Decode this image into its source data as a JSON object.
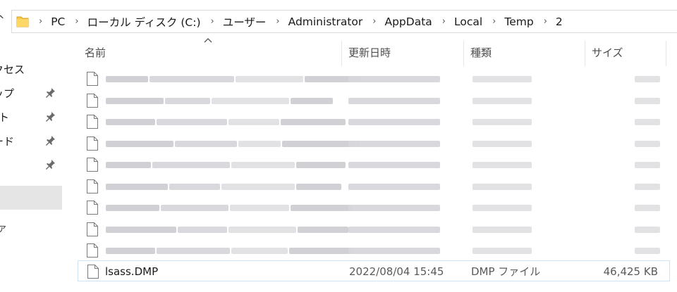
{
  "address_bar": {
    "up_arrow": "^",
    "crumbs": [
      "PC",
      "ローカル ディスク (C:)",
      "ユーザー",
      "Administrator",
      "AppData",
      "Local",
      "Temp",
      "2"
    ],
    "separator": "›"
  },
  "nav_pane": {
    "items": [
      {
        "label": "クセス",
        "pinned": false
      },
      {
        "label": "ップ",
        "pinned": true
      },
      {
        "label": "ト",
        "pinned": true
      },
      {
        "label": "ード",
        "pinned": true
      },
      {
        "label": "",
        "pinned": true
      }
    ],
    "partial_label": "ァ"
  },
  "columns": {
    "name": "名前",
    "date": "更新日時",
    "type": "種類",
    "size": "サイズ"
  },
  "files": {
    "blurred_rows": 9,
    "visible": {
      "name": "lsass.DMP",
      "date": "2022/08/04 15:45",
      "type": "DMP ファイル",
      "size": "46,425 KB"
    }
  },
  "colors": {
    "selection": "#e5e5e5",
    "row_highlight_border": "#cfe3f5",
    "folder_yellow": "#f5c84b"
  }
}
